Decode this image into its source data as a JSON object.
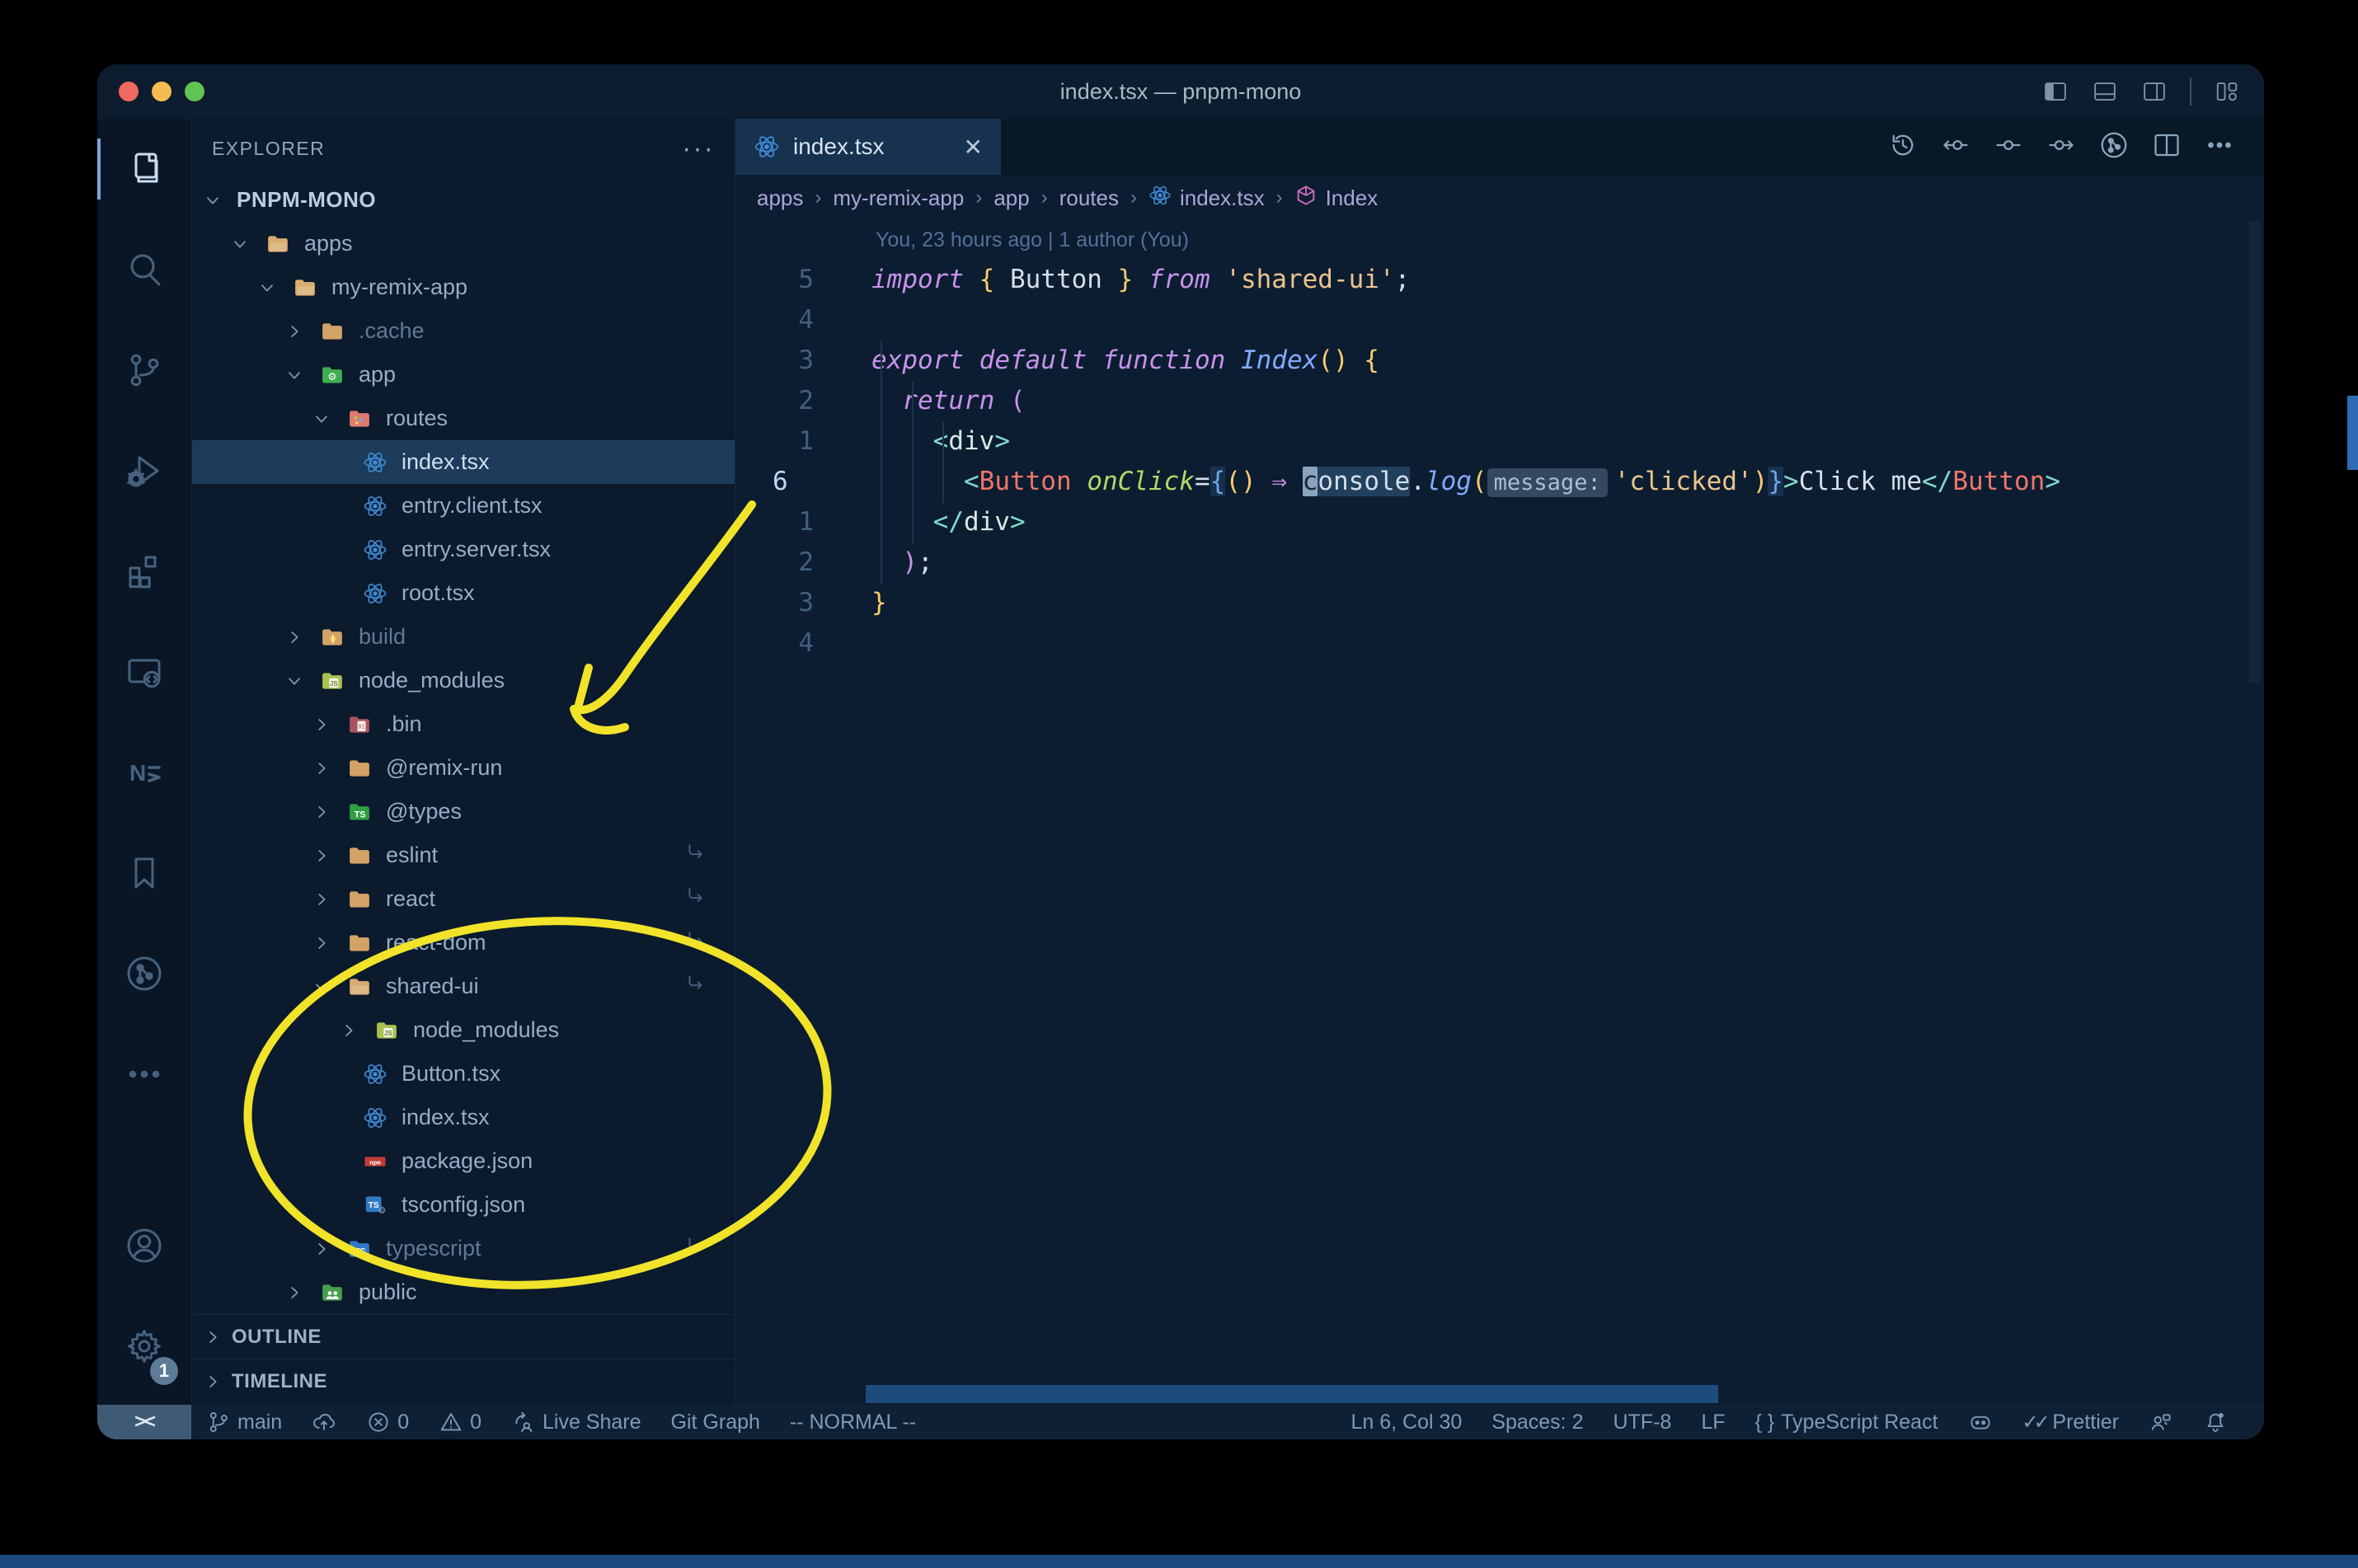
{
  "window": {
    "title": "index.tsx — pnpm-mono",
    "traffic_lights": [
      "#ee6a5f",
      "#f5bd4f",
      "#61c454"
    ],
    "titlebar_icons": [
      "panel-left",
      "panel-bottom",
      "panel-right",
      "sep",
      "layouts"
    ]
  },
  "colors": {
    "annotation_yellow": "#f0e32a",
    "accent_blue": "#82aaff",
    "folder_tan": "#d2a266",
    "react_blue": "#3f8cd5",
    "npm_red": "#c23c3a",
    "ts_blue": "#2f7bc3",
    "selection_row": "#1d3b5a"
  },
  "activity_bar": {
    "top": [
      {
        "name": "explorer",
        "icon": "files",
        "active": true
      },
      {
        "name": "search",
        "icon": "search"
      },
      {
        "name": "source-control",
        "icon": "branch"
      },
      {
        "name": "run-debug",
        "icon": "debug"
      },
      {
        "name": "extensions",
        "icon": "extensions"
      },
      {
        "name": "remote-explorer",
        "icon": "monitor"
      },
      {
        "name": "nx-console",
        "icon": "nx"
      },
      {
        "name": "bookmarks",
        "icon": "bookmark"
      },
      {
        "name": "git-graph",
        "icon": "gitgraph"
      },
      {
        "name": "more-views",
        "icon": "dots"
      }
    ],
    "bottom": [
      {
        "name": "accounts",
        "icon": "account"
      },
      {
        "name": "settings",
        "icon": "gear",
        "badge": "1"
      }
    ]
  },
  "sidebar": {
    "header": "EXPLORER",
    "actions_label": "···",
    "tree": [
      {
        "label": "PNPM-MONO",
        "level": 0,
        "kind": "root",
        "chevron": "open"
      },
      {
        "label": "apps",
        "level": 1,
        "kind": "folder",
        "chevron": "open",
        "icon": "tan-open"
      },
      {
        "label": "my-remix-app",
        "level": 2,
        "kind": "folder",
        "chevron": "open",
        "icon": "tan-open"
      },
      {
        "label": ".cache",
        "level": 3,
        "kind": "folder",
        "chevron": "closed",
        "icon": "tan",
        "dimmed": true
      },
      {
        "label": "app",
        "level": 3,
        "kind": "folder",
        "chevron": "open",
        "icon": "app"
      },
      {
        "label": "routes",
        "level": 4,
        "kind": "folder",
        "chevron": "open",
        "icon": "routes"
      },
      {
        "label": "index.tsx",
        "level": 5,
        "kind": "file",
        "icon": "react",
        "selected": true
      },
      {
        "label": "entry.client.tsx",
        "level": 5,
        "kind": "file",
        "icon": "react"
      },
      {
        "label": "entry.server.tsx",
        "level": 5,
        "kind": "file",
        "icon": "react"
      },
      {
        "label": "root.tsx",
        "level": 5,
        "kind": "file",
        "icon": "react"
      },
      {
        "label": "build",
        "level": 3,
        "kind": "folder",
        "chevron": "closed",
        "icon": "build",
        "dimmed": true
      },
      {
        "label": "node_modules",
        "level": 3,
        "kind": "folder",
        "chevron": "open",
        "icon": "nm"
      },
      {
        "label": ".bin",
        "level": 4,
        "kind": "folder",
        "chevron": "closed",
        "icon": "bin"
      },
      {
        "label": "@remix-run",
        "level": 4,
        "kind": "folder",
        "chevron": "closed",
        "icon": "tan"
      },
      {
        "label": "@types",
        "level": 4,
        "kind": "folder",
        "chevron": "closed",
        "icon": "types"
      },
      {
        "label": "eslint",
        "level": 4,
        "kind": "folder",
        "chevron": "closed",
        "icon": "tan",
        "symlink": true
      },
      {
        "label": "react",
        "level": 4,
        "kind": "folder",
        "chevron": "closed",
        "icon": "tan",
        "symlink": true
      },
      {
        "label": "react-dom",
        "level": 4,
        "kind": "folder",
        "chevron": "closed",
        "icon": "tan",
        "symlink": true
      },
      {
        "label": "shared-ui",
        "level": 4,
        "kind": "folder",
        "chevron": "open",
        "icon": "tan-open",
        "symlink": true
      },
      {
        "label": "node_modules",
        "level": 5,
        "kind": "folder",
        "chevron": "closed",
        "icon": "nm"
      },
      {
        "label": "Button.tsx",
        "level": 5,
        "kind": "file",
        "icon": "react"
      },
      {
        "label": "index.tsx",
        "level": 5,
        "kind": "file",
        "icon": "react"
      },
      {
        "label": "package.json",
        "level": 5,
        "kind": "file",
        "icon": "npm"
      },
      {
        "label": "tsconfig.json",
        "level": 5,
        "kind": "file",
        "icon": "tsconfig"
      },
      {
        "label": "typescript",
        "level": 4,
        "kind": "folder",
        "chevron": "closed",
        "icon": "ts-folder",
        "dimmed": true,
        "symlink": true
      },
      {
        "label": "public",
        "level": 3,
        "kind": "folder",
        "chevron": "closed",
        "icon": "public"
      }
    ],
    "sections": [
      "OUTLINE",
      "TIMELINE"
    ]
  },
  "editor": {
    "tab": {
      "label": "index.tsx",
      "close": "✕"
    },
    "actions": [
      "history",
      "prev",
      "current",
      "next",
      "gitgraph-circle",
      "split",
      "more"
    ],
    "breadcrumbs": [
      {
        "label": "apps"
      },
      {
        "label": "my-remix-app"
      },
      {
        "label": "app"
      },
      {
        "label": "routes"
      },
      {
        "label": "index.tsx",
        "icon": "react"
      },
      {
        "label": "Index",
        "icon": "cube"
      }
    ],
    "blame": "You, 23 hours ago | 1 author (You)",
    "lines": [
      {
        "num": "5",
        "tokens": [
          [
            "import ",
            "kw"
          ],
          [
            "{",
            "gold"
          ],
          [
            " Button ",
            "plain"
          ],
          [
            "}",
            "gold"
          ],
          [
            " from ",
            "kw"
          ],
          [
            "'shared-ui'",
            "str"
          ],
          [
            ";",
            "plain"
          ]
        ]
      },
      {
        "num": "4",
        "tokens": []
      },
      {
        "num": "3",
        "tokens": [
          [
            "export ",
            "kw"
          ],
          [
            "default ",
            "kw"
          ],
          [
            "function ",
            "kw"
          ],
          [
            "Index",
            "fn"
          ],
          [
            "()",
            "gold"
          ],
          [
            " ",
            "plain"
          ],
          [
            "{",
            "gold"
          ]
        ]
      },
      {
        "num": "2",
        "tokens": [
          [
            "  ",
            "plain"
          ],
          [
            "return ",
            "kw"
          ],
          [
            "(",
            "mag"
          ]
        ]
      },
      {
        "num": "1",
        "tokens": [
          [
            "    ",
            "plain"
          ],
          [
            "<",
            "tagb"
          ],
          [
            "div",
            "tagn"
          ],
          [
            ">",
            "tagb"
          ]
        ]
      },
      {
        "num": "6",
        "current": true,
        "tokens": [
          [
            "      ",
            "plain"
          ],
          [
            "<",
            "tagb"
          ],
          [
            "Button",
            "comp"
          ],
          [
            " ",
            "plain"
          ],
          [
            "onClick",
            "attr"
          ],
          [
            "=",
            "plain"
          ],
          [
            "{",
            "matchL"
          ],
          [
            "()",
            "gold"
          ],
          [
            " ",
            "plain"
          ],
          [
            "⇒",
            "arrow"
          ],
          [
            " ",
            "plain"
          ],
          [
            "c",
            "cursor"
          ],
          [
            "onsole",
            "wordhl"
          ],
          [
            ".",
            "plain"
          ],
          [
            "log",
            "method"
          ],
          [
            "(",
            "gold"
          ],
          [
            "message:",
            "inlay"
          ],
          [
            "'clicked'",
            "str"
          ],
          [
            ")",
            "gold"
          ],
          [
            "}",
            "matchR"
          ],
          [
            ">",
            "tagb"
          ],
          [
            "Click me",
            "plain"
          ],
          [
            "</",
            "tagb"
          ],
          [
            "Button",
            "comp"
          ],
          [
            ">",
            "tagb"
          ]
        ]
      },
      {
        "num": "1",
        "tokens": [
          [
            "    ",
            "plain"
          ],
          [
            "</",
            "tagb"
          ],
          [
            "div",
            "tagn"
          ],
          [
            ">",
            "tagb"
          ]
        ]
      },
      {
        "num": "2",
        "tokens": [
          [
            "  ",
            "plain"
          ],
          [
            ")",
            "mag"
          ],
          [
            ";",
            "plain"
          ]
        ]
      },
      {
        "num": "3",
        "tokens": [
          [
            "}",
            "gold"
          ]
        ]
      },
      {
        "num": "4",
        "tokens": []
      }
    ]
  },
  "status_bar": {
    "remote": "><",
    "left": [
      {
        "icon": "branch",
        "label": "main",
        "name": "branch-indicator"
      },
      {
        "icon": "cloud-up",
        "label": "",
        "name": "sync-button"
      },
      {
        "icon": "error",
        "label": "0",
        "name": "errors"
      },
      {
        "icon": "warning",
        "label": "0",
        "name": "warnings"
      },
      {
        "icon": "liveshare",
        "label": "Live Share",
        "name": "live-share"
      },
      {
        "icon": "",
        "label": "Git Graph",
        "name": "git-graph"
      },
      {
        "icon": "",
        "label": "-- NORMAL --",
        "name": "vim-mode"
      }
    ],
    "right": [
      {
        "icon": "",
        "label": "Ln 6, Col 30",
        "name": "cursor-position"
      },
      {
        "icon": "",
        "label": "Spaces: 2",
        "name": "indentation"
      },
      {
        "icon": "",
        "label": "UTF-8",
        "name": "encoding"
      },
      {
        "icon": "",
        "label": "LF",
        "name": "eol"
      },
      {
        "icon": "braces",
        "label": "TypeScript React",
        "name": "language-mode"
      },
      {
        "icon": "copilot",
        "label": "",
        "name": "copilot"
      },
      {
        "icon": "checks",
        "label": "Prettier",
        "name": "prettier"
      },
      {
        "icon": "feedback",
        "label": "",
        "name": "feedback"
      },
      {
        "icon": "bell-dot",
        "label": "",
        "name": "notifications"
      }
    ]
  }
}
